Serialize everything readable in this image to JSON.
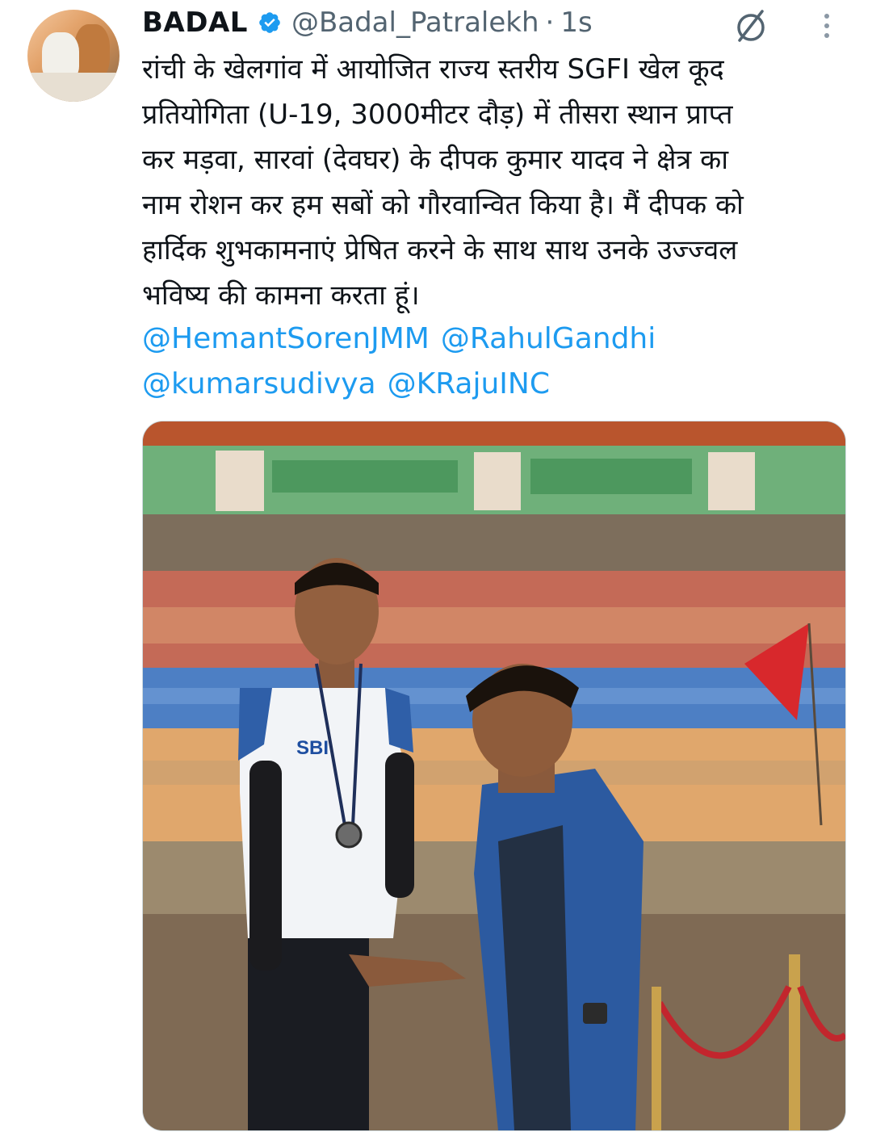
{
  "tweet": {
    "author_name": "BADAL",
    "author_handle": "@Badal_Patralekh",
    "separator": "·",
    "timestamp": "1s",
    "verified": true,
    "text_lines": [
      "रांची के खेलगांव में आयोजित राज्य स्तरीय  SGFI खेल कूद",
      "प्रतियोगिता (U-19, 3000मीटर दौड़) में तीसरा स्थान प्राप्त",
      "कर मड़वा, सारवां (देवघर) के  दीपक कुमार यादव ने क्षेत्र का",
      "नाम रोशन कर हम सबों को गौरवान्वित किया है। मैं दीपक को",
      "हार्दिक शुभकामनाएं प्रेषित करने के साथ साथ उनके उज्ज्वल",
      "भविष्य की कामना करता हूं।"
    ],
    "mentions": [
      "@HemantSorenJMM",
      "@RahulGandhi",
      "@kumarsudivya",
      "@KRajuINC"
    ]
  },
  "media": {
    "jersey_text": "SBI"
  },
  "icons": {
    "avatar": "profile-photo",
    "verified": "verified-badge-icon",
    "grok": "grok-icon",
    "more": "more-vertical-icon"
  },
  "colors": {
    "text": "#0f1419",
    "secondary": "#536471",
    "link": "#1d9bf0",
    "verified": "#1d9bf0"
  }
}
